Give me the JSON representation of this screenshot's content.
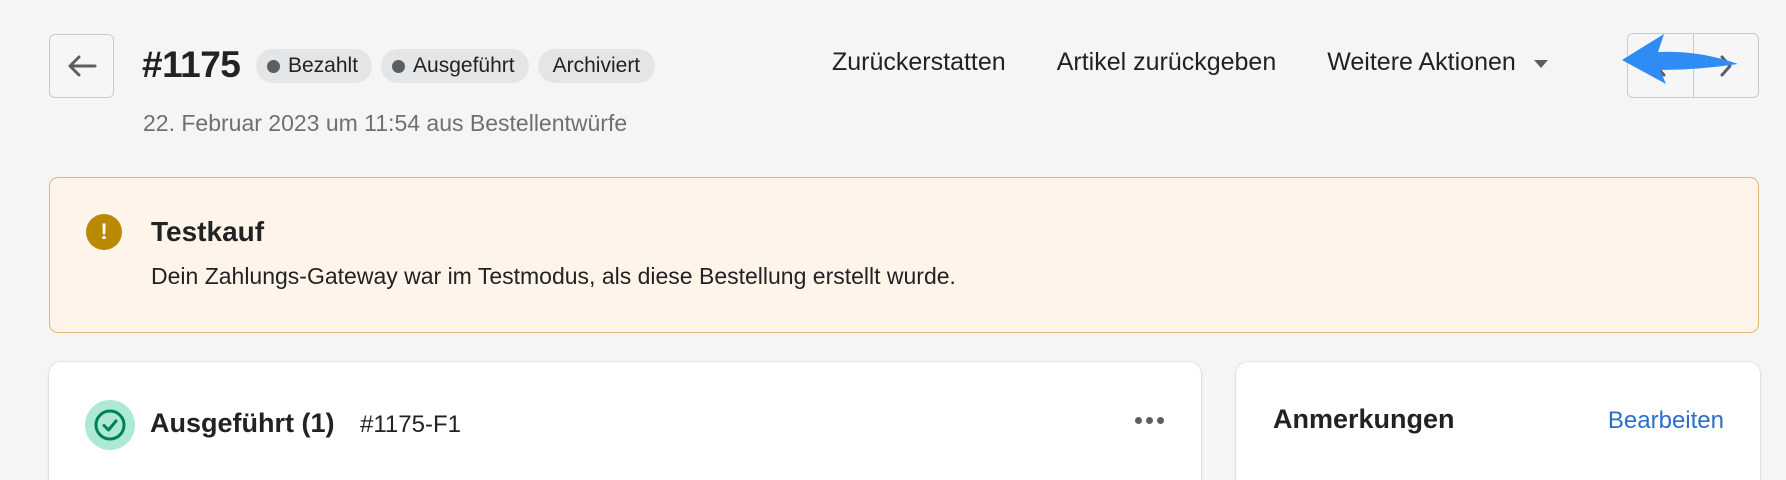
{
  "header": {
    "order_number": "#1175",
    "badges": [
      {
        "label": "Bezahlt",
        "has_dot": true
      },
      {
        "label": "Ausgeführt",
        "has_dot": true
      },
      {
        "label": "Archiviert",
        "has_dot": false
      }
    ],
    "subtitle": "22. Februar 2023 um 11:54 aus Bestellentwürfe",
    "actions": {
      "refund": "Zurückerstatten",
      "return_items": "Artikel zurückgeben",
      "more_actions": "Weitere Aktionen"
    },
    "icons": {
      "back": "arrow-left-icon",
      "previous": "chevron-left-icon",
      "next": "chevron-right-icon",
      "more_caret": "caret-down-icon"
    }
  },
  "banner": {
    "title": "Testkauf",
    "text": "Dein Zahlungs-Gateway war im Testmodus, als diese Bestellung erstellt wurde.",
    "icon": "alert-icon",
    "icon_glyph": "!"
  },
  "fulfillment_card": {
    "title": "Ausgeführt (1)",
    "fulfillment_id": "#1175-F1",
    "icon": "check-circle-icon"
  },
  "notes_card": {
    "title": "Anmerkungen",
    "edit_label": "Bearbeiten"
  },
  "colors": {
    "background": "#f5f5f5",
    "banner_bg": "#fff4e9",
    "banner_border": "#e1b878",
    "warning_icon": "#b98900",
    "success_bg": "#aee9d1",
    "success_icon": "#007f5f",
    "link": "#2c6ecb",
    "annotation_arrow": "#2f8cf5"
  }
}
